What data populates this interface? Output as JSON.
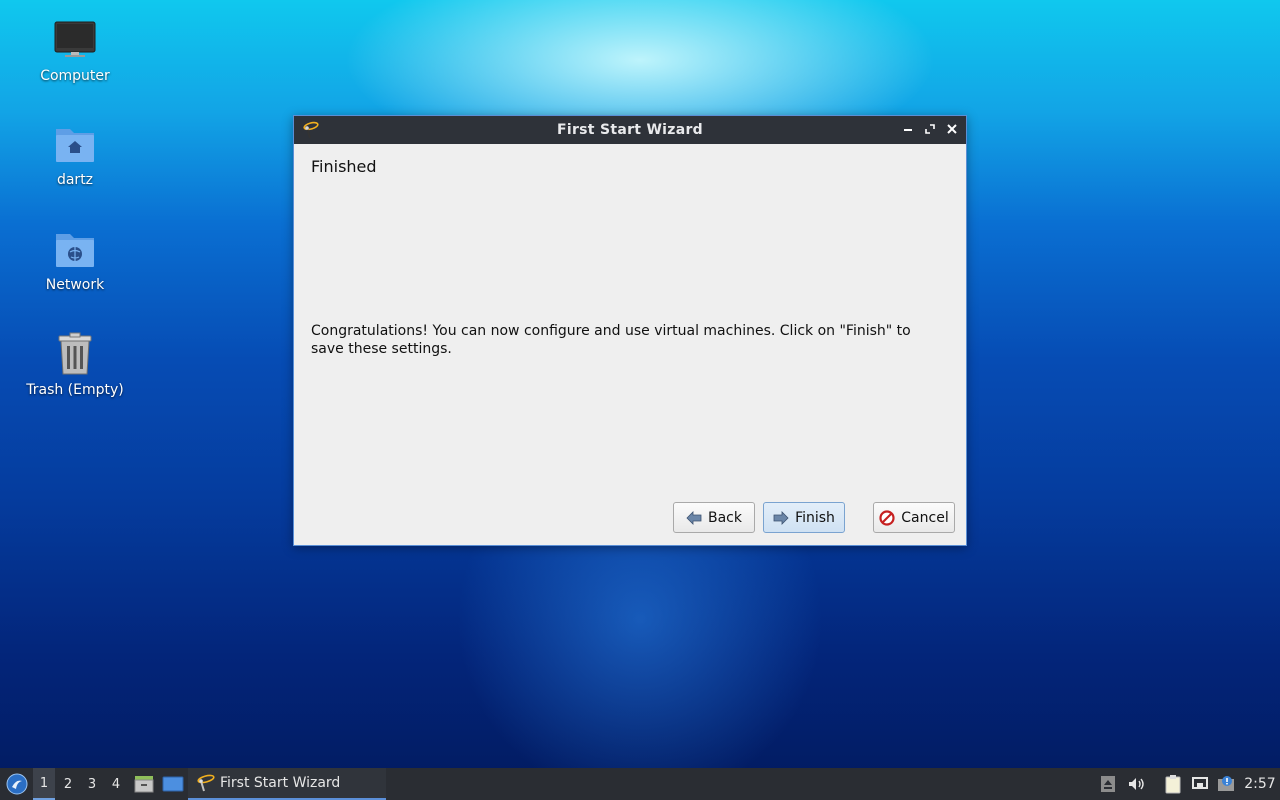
{
  "desktop": {
    "icons": [
      {
        "label": "Computer",
        "icon": "computer-icon"
      },
      {
        "label": "dartz",
        "icon": "home-folder-icon"
      },
      {
        "label": "Network",
        "icon": "network-folder-icon"
      },
      {
        "label": "Trash (Empty)",
        "icon": "trash-icon"
      }
    ]
  },
  "window": {
    "title": "First Start Wizard",
    "heading": "Finished",
    "message": "Congratulations! You can now configure and use virtual machines. Click on \"Finish\" to save these settings.",
    "buttons": {
      "back": "Back",
      "finish": "Finish",
      "cancel": "Cancel"
    }
  },
  "taskbar": {
    "workspaces": [
      "1",
      "2",
      "3",
      "4"
    ],
    "active_workspace": "1",
    "task_label": "First Start Wizard",
    "clock": "2:57"
  },
  "colors": {
    "accent": "#5b8fd9",
    "titlebar": "#2e3239",
    "taskbar": "#2a2d33"
  }
}
